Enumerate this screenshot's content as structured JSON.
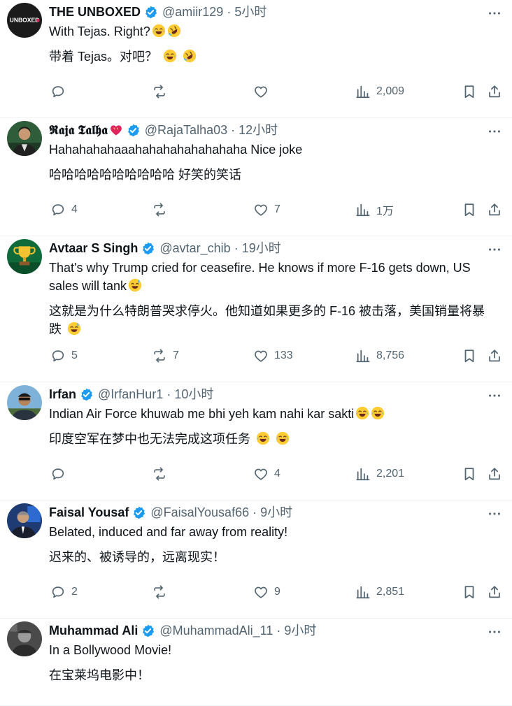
{
  "feed": {
    "tweets": [
      {
        "name": "THE UNBOXED",
        "handle_time": "@amiir129 · 5小时",
        "avatar_text": "UNBOXED",
        "avatar_kind": "unboxed",
        "body_lines": [
          "With Tejas. Right?"
        ],
        "body_emoji": [
          "joy",
          "rofl"
        ],
        "translation": "带着 Tejas。对吧？",
        "translation_emoji": [
          "joy",
          "rofl"
        ],
        "replies": "",
        "retweets": "",
        "likes": "",
        "views": "2,009"
      },
      {
        "name": "𝕽𝖆𝖏𝖆 𝕿𝖆𝖑𝖍𝖆",
        "handle_time": "@RajaTalha03 · 12小时",
        "avatar_kind": "raja",
        "name_emoji": [
          "heart"
        ],
        "body_lines": [
          "Hahahahahaaahahahahahahahaha Nice joke"
        ],
        "body_emoji": [],
        "translation": "哈哈哈哈哈哈哈哈哈哈 好笑的笑话",
        "translation_emoji": [],
        "replies": "4",
        "retweets": "",
        "likes": "7",
        "views": "1万"
      },
      {
        "name": "Avtaar S Singh",
        "handle_time": "@avtar_chib · 19小时",
        "avatar_kind": "trophy",
        "body_lines": [
          "That's why Trump cried for ceasefire. He knows if more F-16 gets down, US",
          "sales will tank"
        ],
        "body_emoji": [
          "sweat"
        ],
        "translation_lines": [
          "这就是为什么特朗普哭求停火。他知道如果更多的 F-16 被击落，美国销量将暴",
          "跌"
        ],
        "translation_emoji": [
          "sweat"
        ],
        "replies": "5",
        "retweets": "7",
        "likes": "133",
        "views": "8,756"
      },
      {
        "name": "Irfan",
        "handle_time": "@IrfanHur1 · 10小时",
        "avatar_kind": "irfan",
        "body_lines": [
          "Indian Air Force khuwab me bhi yeh kam nahi kar sakti"
        ],
        "body_emoji": [
          "joy",
          "joy"
        ],
        "translation": "印度空军在梦中也无法完成这项任务",
        "translation_emoji": [
          "joy",
          "joy"
        ],
        "replies": "",
        "retweets": "",
        "likes": "4",
        "views": "2,201"
      },
      {
        "name": "Faisal Yousaf",
        "handle_time": "@FaisalYousaf66 · 9小时",
        "avatar_kind": "faisal",
        "body_lines": [
          "Belated, induced and far away from reality!"
        ],
        "body_emoji": [],
        "translation": "迟来的、被诱导的，远离现实！",
        "translation_emoji": [],
        "replies": "2",
        "retweets": "",
        "likes": "9",
        "views": "2,851"
      },
      {
        "name": "Muhammad Ali",
        "handle_time": "@MuhammadAli_11 · 9小时",
        "avatar_kind": "ali",
        "body_lines": [
          "In a Bollywood Movie!"
        ],
        "body_emoji": [],
        "translation": "在宝莱坞电影中！",
        "translation_emoji": [],
        "replies": "",
        "retweets": "",
        "likes": "",
        "views": ""
      }
    ]
  },
  "colors": {
    "text": "#0f1419",
    "muted": "#536471",
    "verified": "#1d9bf0",
    "divider": "#eff3f4"
  },
  "icons": [
    "reply-icon",
    "retweet-icon",
    "like-icon",
    "views-icon",
    "bookmark-icon",
    "share-icon",
    "more-icon",
    "verified-badge-icon"
  ]
}
